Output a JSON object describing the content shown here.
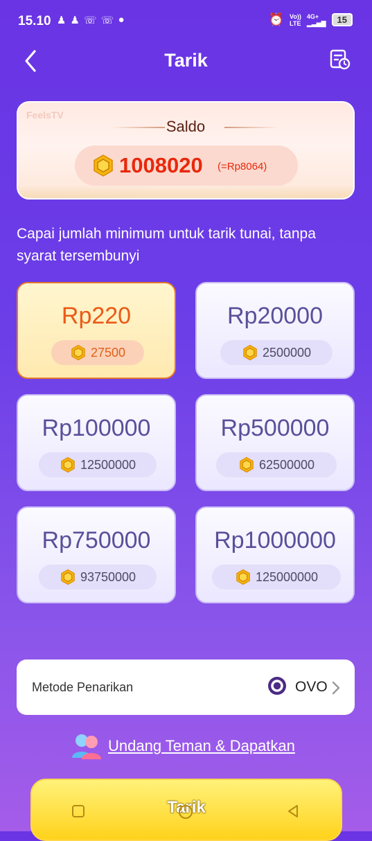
{
  "status_bar": {
    "time": "15.10",
    "network_top": "Vo))",
    "network_bottom": "LTE",
    "network_type": "4G+",
    "battery": "15"
  },
  "header": {
    "title": "Tarik",
    "back_icon": "chevron-left-icon",
    "history_icon": "history-icon"
  },
  "balance": {
    "watermark": "FeelsTV",
    "label": "Saldo",
    "coins": "1008020",
    "converted": "(=Rp8064)"
  },
  "note": "Capai jumlah minimum untuk tarik tunai, tanpa syarat tersembunyi",
  "options": [
    {
      "price": "Rp220",
      "coins": "27500",
      "selected": true
    },
    {
      "price": "Rp20000",
      "coins": "2500000",
      "selected": false
    },
    {
      "price": "Rp100000",
      "coins": "12500000",
      "selected": false
    },
    {
      "price": "Rp500000",
      "coins": "62500000",
      "selected": false
    },
    {
      "price": "Rp750000",
      "coins": "93750000",
      "selected": false
    },
    {
      "price": "Rp1000000",
      "coins": "125000000",
      "selected": false
    }
  ],
  "method": {
    "label": "Metode Penarikan",
    "value": "OVO"
  },
  "invite": {
    "text": "Undang Teman & Dapatkan"
  },
  "withdraw_button": {
    "label": "Tarik"
  },
  "colors": {
    "accent": "#6a34e4",
    "selected_price": "#ea5a17",
    "balance_amount": "#e8280c",
    "button": "#ffd21b"
  }
}
